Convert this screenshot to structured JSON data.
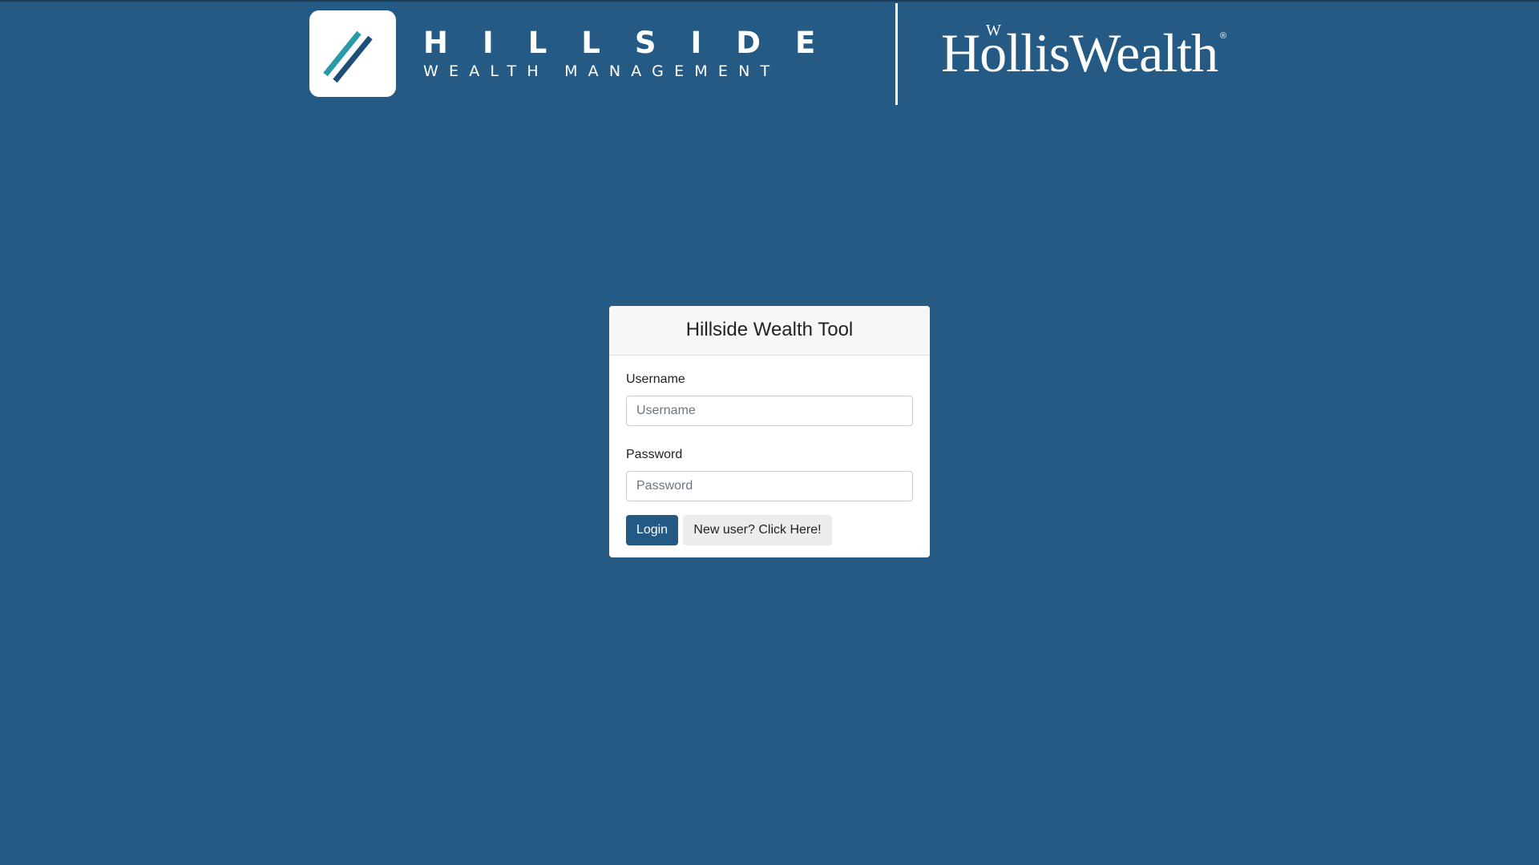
{
  "header": {
    "brand_name": "HILLSIDE",
    "brand_subtitle": "WEALTH MANAGEMENT",
    "partner_name": "HollisWealth",
    "partner_mark": "W",
    "partner_registered": "®"
  },
  "login": {
    "title": "Hillside Wealth Tool",
    "username": {
      "label": "Username",
      "placeholder": "Username",
      "value": ""
    },
    "password": {
      "label": "Password",
      "placeholder": "Password",
      "value": ""
    },
    "login_label": "Login",
    "new_user_label": "New user? Click Here!"
  },
  "colors": {
    "background": "#255a85",
    "primary_button": "#235a85",
    "logo_teal": "#2a9aa8",
    "logo_navy": "#1f4e79"
  },
  "icons": {
    "logo": "hillside-slash-mark"
  }
}
